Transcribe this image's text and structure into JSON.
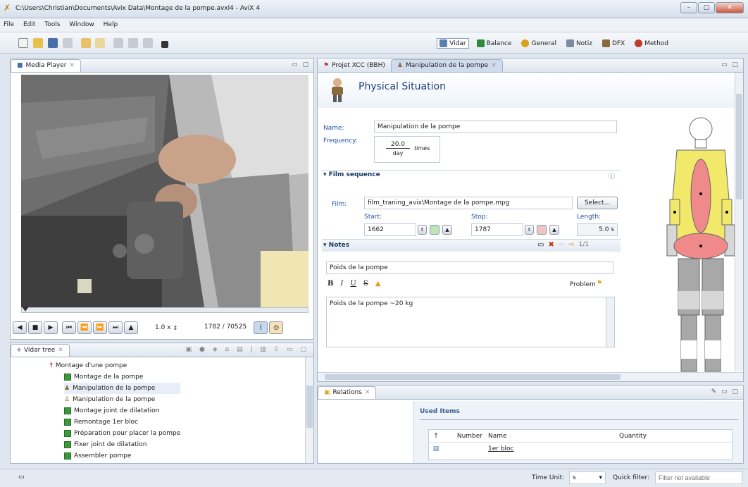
{
  "window": {
    "title": "C:\\Users\\Christian\\Documents\\Avix Data\\Montage de la pompe.avxl4 - AviX 4"
  },
  "menu": [
    "File",
    "Edit",
    "Tools",
    "Window",
    "Help"
  ],
  "perspectives": [
    {
      "label": "Vidar",
      "color": "#5a7fb0",
      "active": true
    },
    {
      "label": "Balance",
      "color": "#2e8b3c",
      "active": false
    },
    {
      "label": "General",
      "color": "#d9a21b",
      "active": false
    },
    {
      "label": "Notiz",
      "color": "#7a8aa0",
      "active": false
    },
    {
      "label": "DFX",
      "color": "#8a6a3a",
      "active": false
    },
    {
      "label": "Method",
      "color": "#c43a2a",
      "active": false
    }
  ],
  "media_player": {
    "tab": "Media Player",
    "speed": "1.0 x",
    "frame": "1782 / 70525"
  },
  "vidar_tree": {
    "tab": "Vidar tree",
    "root": "Montage d'une pompe",
    "items": [
      "Montage de la pompe",
      "Manipulation de la pompe",
      "Manipulation de la pompe",
      "Montage joint de dilatation",
      "Remontage 1er bloc",
      "Préparation pour placer la pompe",
      "Fixer joint de dilatation",
      "Assembler pompe"
    ]
  },
  "editor": {
    "tabs": [
      "Projet XCC (BBH)",
      "Manipulation de la pompe"
    ],
    "heading": "Physical Situation",
    "name_label": "Name:",
    "name_value": "Manipulation de la pompe",
    "frequency_label": "Frequency:",
    "freq_num": "20.0",
    "freq_den": "day",
    "freq_unit": "times"
  },
  "film": {
    "section": "Film sequence",
    "film_label": "Film:",
    "film_value": "film_traning_avix\\Montage de la pompe.mpg",
    "select_btn": "Select...",
    "start_label": "Start:",
    "start_value": "1662",
    "stop_label": "Stop:",
    "stop_value": "1787",
    "length_label": "Length:",
    "length_value": "5.0 s"
  },
  "notes": {
    "section": "Notes",
    "page": "1/1",
    "title_value": "Poids de la pompe",
    "problem_label": "Problem",
    "body": "Poids de la pompe ~20 kg",
    "format": [
      "B",
      "I",
      "U",
      "S"
    ]
  },
  "relations": {
    "tab": "Relations",
    "used_items": "Used Items",
    "columns": [
      "Number",
      "Name",
      "Quantity"
    ],
    "rows": [
      {
        "number": "",
        "name": "1er bloc",
        "quantity": ""
      }
    ]
  },
  "status": {
    "time_unit_label": "Time Unit:",
    "time_unit_value": "s",
    "quick_filter_label": "Quick filter:",
    "quick_filter_placeholder": "Filter not available"
  }
}
